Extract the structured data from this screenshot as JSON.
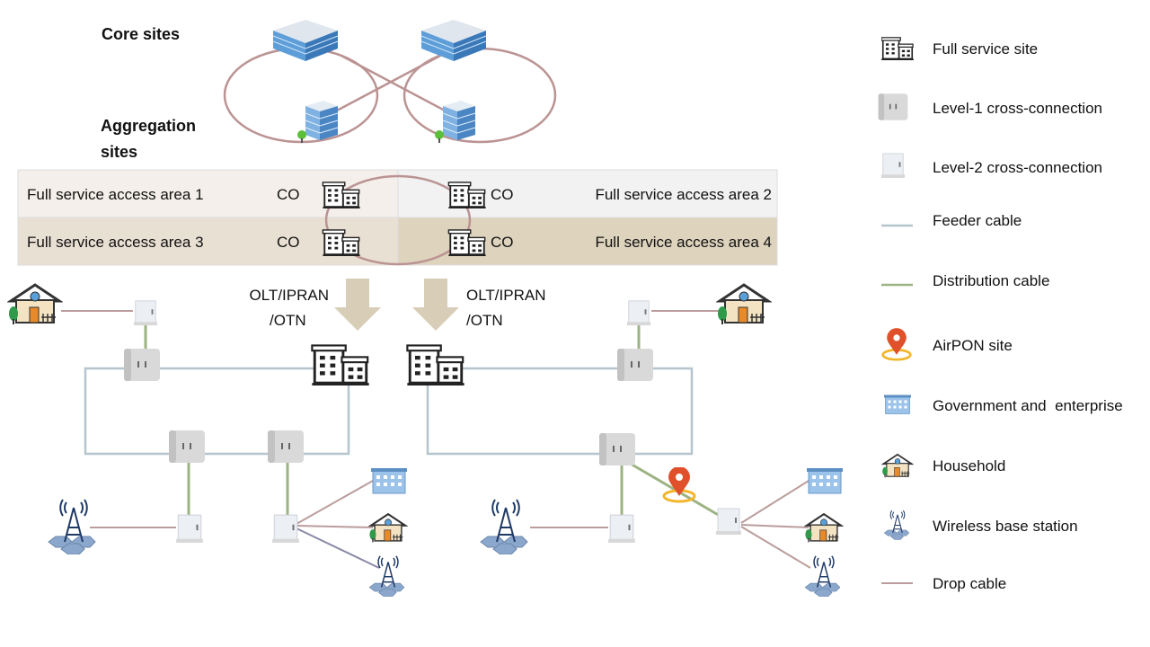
{
  "labels": {
    "core_sites": "Core sites",
    "aggregation_sites_line1": "Aggregation",
    "aggregation_sites_line2": "sites"
  },
  "areas": [
    {
      "name": "Full service access area 1",
      "co": "CO"
    },
    {
      "name": "Full service access area 2",
      "co": "CO"
    },
    {
      "name": "Full service access area 3",
      "co": "CO"
    },
    {
      "name": "Full service access area 4",
      "co": "CO"
    }
  ],
  "arrows": {
    "left_line1": "OLT/IPRAN",
    "left_line2": "/OTN",
    "right_line1": "OLT/IPRAN",
    "right_line2": "/OTN"
  },
  "legend": [
    {
      "icon": "full-service-site-icon",
      "label": "Full service site"
    },
    {
      "icon": "level1-cabinet-icon",
      "label": "Level-1 cross-connection"
    },
    {
      "icon": "level2-cabinet-icon",
      "label": "Level-2 cross-connection"
    },
    {
      "icon": "feeder-cable-line",
      "label": "Feeder cable"
    },
    {
      "icon": "distribution-cable-line",
      "label": "Distribution cable"
    },
    {
      "icon": "airpon-pin-icon",
      "label": "AirPON site"
    },
    {
      "icon": "government-building-icon",
      "label": "Government and  enterprise"
    },
    {
      "icon": "household-icon",
      "label": "Household"
    },
    {
      "icon": "base-station-icon",
      "label": "Wireless base station"
    },
    {
      "icon": "drop-cable-line",
      "label": "Drop cable"
    }
  ],
  "colors": {
    "feeder": "#b5c5cd",
    "distribution": "#9cb383",
    "drop": "#bb9d9d",
    "ring": "#bb9393",
    "area1": "#f4efea",
    "area2": "#f2f2f2",
    "area3": "#e9e0d4",
    "area4": "#ded3bd",
    "arrow": "#d8ceb8",
    "pin": "#e0502a"
  }
}
